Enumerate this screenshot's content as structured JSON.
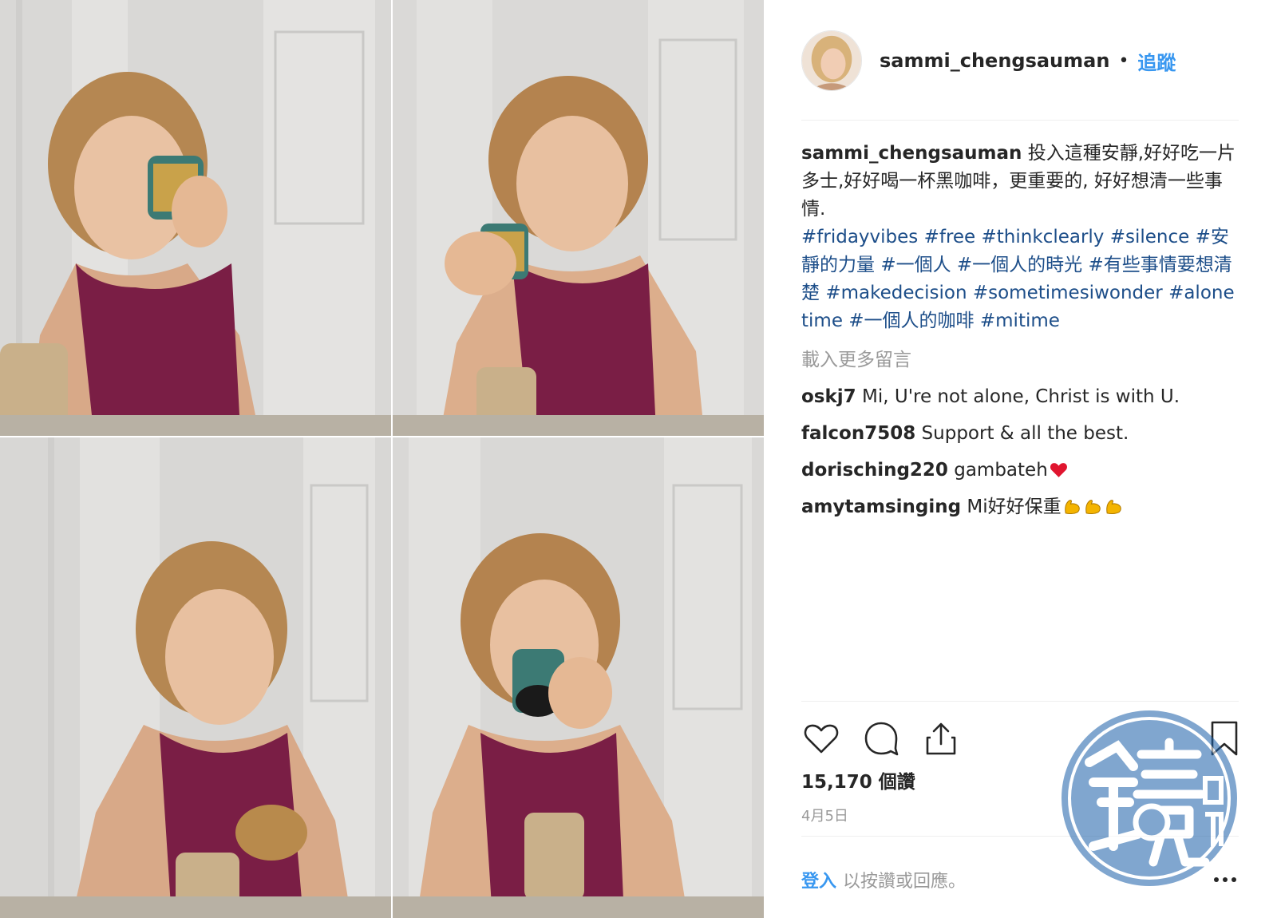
{
  "post": {
    "username": "sammi_chengsauman",
    "separator": "•",
    "follow_label": "追蹤",
    "caption": "投入這種安靜,好好吃一片多士,好好喝一杯黑咖啡，更重要的, 好好想清一些事情.",
    "hashtags": [
      "#fridayvibes",
      "#free",
      "#thinkclearly",
      "#silence",
      "#安靜的力量",
      "#一個人",
      "#一個人的時光",
      "#有些事情要想清楚",
      "#makedecision",
      "#sometimesiwonder",
      "#alonetime",
      "#一個人的咖啡",
      "#mitime"
    ],
    "load_more": "載入更多留言",
    "comments": [
      {
        "user": "oskj7",
        "text": "Mi, U're not alone, Christ is with U."
      },
      {
        "user": "falcon7508",
        "text": "Support & all the best."
      },
      {
        "user": "dorisching220",
        "text": "gambateh",
        "emoji": "red-heart"
      },
      {
        "user": "amytamsinging",
        "text": "Mi好好保重",
        "emoji": "flexed-biceps x3"
      }
    ],
    "views": "15,170 個讚",
    "date": "4月5日",
    "login_link": "登入",
    "login_rest": "以按讚或回應。"
  },
  "icons": {
    "like": "heart-icon",
    "comment": "comment-bubble-icon",
    "share": "share-icon",
    "save": "bookmark-icon",
    "more": "more-dots-icon"
  },
  "watermark": {
    "characters": "鏡週刊",
    "color": "#1a5fa8"
  },
  "colors": {
    "link_blue": "#3897f0",
    "hashtag_blue": "#1d4e89",
    "muted_gray": "#999999",
    "tank_top": "#7a1e45"
  }
}
